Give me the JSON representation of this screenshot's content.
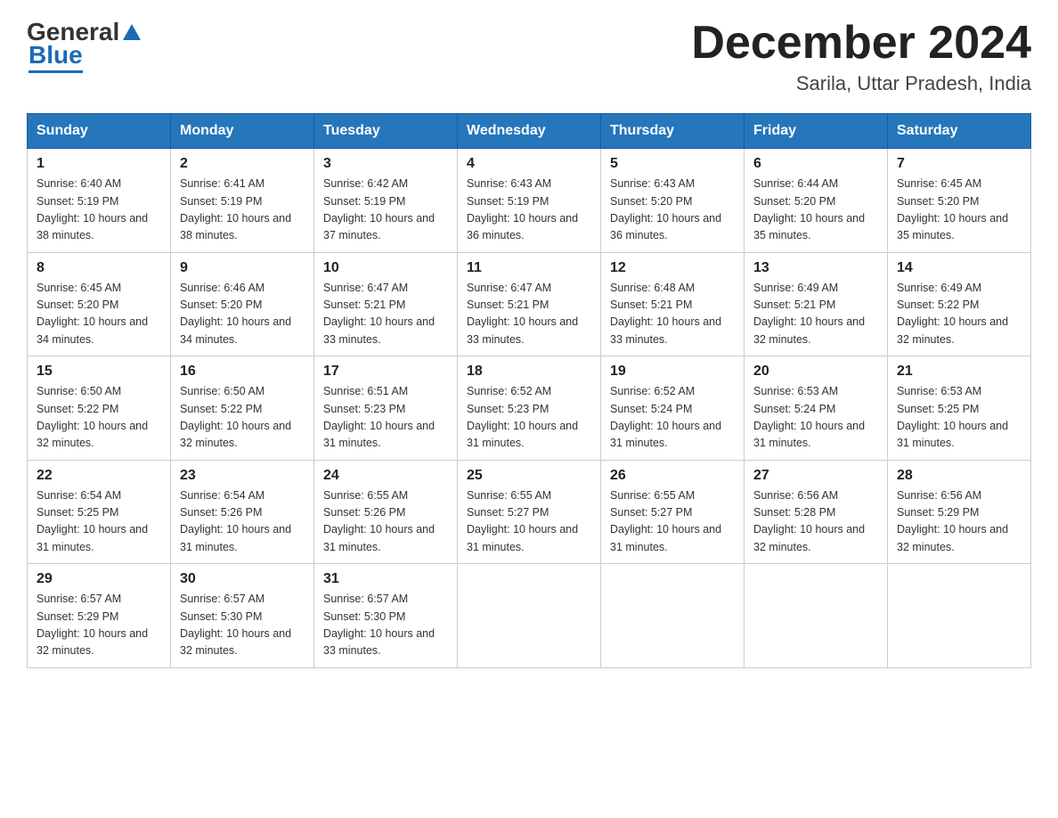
{
  "header": {
    "logo": {
      "general": "General",
      "blue": "Blue"
    },
    "title": "December 2024",
    "location": "Sarila, Uttar Pradesh, India"
  },
  "days_of_week": [
    "Sunday",
    "Monday",
    "Tuesday",
    "Wednesday",
    "Thursday",
    "Friday",
    "Saturday"
  ],
  "weeks": [
    [
      {
        "num": "1",
        "sunrise": "6:40 AM",
        "sunset": "5:19 PM",
        "daylight": "10 hours and 38 minutes."
      },
      {
        "num": "2",
        "sunrise": "6:41 AM",
        "sunset": "5:19 PM",
        "daylight": "10 hours and 38 minutes."
      },
      {
        "num": "3",
        "sunrise": "6:42 AM",
        "sunset": "5:19 PM",
        "daylight": "10 hours and 37 minutes."
      },
      {
        "num": "4",
        "sunrise": "6:43 AM",
        "sunset": "5:19 PM",
        "daylight": "10 hours and 36 minutes."
      },
      {
        "num": "5",
        "sunrise": "6:43 AM",
        "sunset": "5:20 PM",
        "daylight": "10 hours and 36 minutes."
      },
      {
        "num": "6",
        "sunrise": "6:44 AM",
        "sunset": "5:20 PM",
        "daylight": "10 hours and 35 minutes."
      },
      {
        "num": "7",
        "sunrise": "6:45 AM",
        "sunset": "5:20 PM",
        "daylight": "10 hours and 35 minutes."
      }
    ],
    [
      {
        "num": "8",
        "sunrise": "6:45 AM",
        "sunset": "5:20 PM",
        "daylight": "10 hours and 34 minutes."
      },
      {
        "num": "9",
        "sunrise": "6:46 AM",
        "sunset": "5:20 PM",
        "daylight": "10 hours and 34 minutes."
      },
      {
        "num": "10",
        "sunrise": "6:47 AM",
        "sunset": "5:21 PM",
        "daylight": "10 hours and 33 minutes."
      },
      {
        "num": "11",
        "sunrise": "6:47 AM",
        "sunset": "5:21 PM",
        "daylight": "10 hours and 33 minutes."
      },
      {
        "num": "12",
        "sunrise": "6:48 AM",
        "sunset": "5:21 PM",
        "daylight": "10 hours and 33 minutes."
      },
      {
        "num": "13",
        "sunrise": "6:49 AM",
        "sunset": "5:21 PM",
        "daylight": "10 hours and 32 minutes."
      },
      {
        "num": "14",
        "sunrise": "6:49 AM",
        "sunset": "5:22 PM",
        "daylight": "10 hours and 32 minutes."
      }
    ],
    [
      {
        "num": "15",
        "sunrise": "6:50 AM",
        "sunset": "5:22 PM",
        "daylight": "10 hours and 32 minutes."
      },
      {
        "num": "16",
        "sunrise": "6:50 AM",
        "sunset": "5:22 PM",
        "daylight": "10 hours and 32 minutes."
      },
      {
        "num": "17",
        "sunrise": "6:51 AM",
        "sunset": "5:23 PM",
        "daylight": "10 hours and 31 minutes."
      },
      {
        "num": "18",
        "sunrise": "6:52 AM",
        "sunset": "5:23 PM",
        "daylight": "10 hours and 31 minutes."
      },
      {
        "num": "19",
        "sunrise": "6:52 AM",
        "sunset": "5:24 PM",
        "daylight": "10 hours and 31 minutes."
      },
      {
        "num": "20",
        "sunrise": "6:53 AM",
        "sunset": "5:24 PM",
        "daylight": "10 hours and 31 minutes."
      },
      {
        "num": "21",
        "sunrise": "6:53 AM",
        "sunset": "5:25 PM",
        "daylight": "10 hours and 31 minutes."
      }
    ],
    [
      {
        "num": "22",
        "sunrise": "6:54 AM",
        "sunset": "5:25 PM",
        "daylight": "10 hours and 31 minutes."
      },
      {
        "num": "23",
        "sunrise": "6:54 AM",
        "sunset": "5:26 PM",
        "daylight": "10 hours and 31 minutes."
      },
      {
        "num": "24",
        "sunrise": "6:55 AM",
        "sunset": "5:26 PM",
        "daylight": "10 hours and 31 minutes."
      },
      {
        "num": "25",
        "sunrise": "6:55 AM",
        "sunset": "5:27 PM",
        "daylight": "10 hours and 31 minutes."
      },
      {
        "num": "26",
        "sunrise": "6:55 AM",
        "sunset": "5:27 PM",
        "daylight": "10 hours and 31 minutes."
      },
      {
        "num": "27",
        "sunrise": "6:56 AM",
        "sunset": "5:28 PM",
        "daylight": "10 hours and 32 minutes."
      },
      {
        "num": "28",
        "sunrise": "6:56 AM",
        "sunset": "5:29 PM",
        "daylight": "10 hours and 32 minutes."
      }
    ],
    [
      {
        "num": "29",
        "sunrise": "6:57 AM",
        "sunset": "5:29 PM",
        "daylight": "10 hours and 32 minutes."
      },
      {
        "num": "30",
        "sunrise": "6:57 AM",
        "sunset": "5:30 PM",
        "daylight": "10 hours and 32 minutes."
      },
      {
        "num": "31",
        "sunrise": "6:57 AM",
        "sunset": "5:30 PM",
        "daylight": "10 hours and 33 minutes."
      },
      null,
      null,
      null,
      null
    ]
  ]
}
